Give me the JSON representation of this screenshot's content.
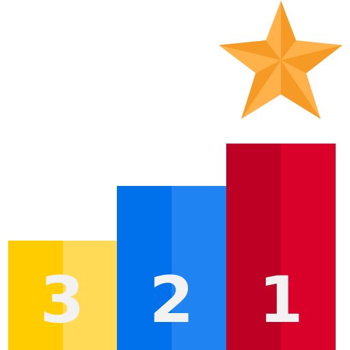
{
  "icon": {
    "name": "podium-ranking-icon",
    "star": {
      "icon_name": "star-icon"
    },
    "steps": [
      {
        "rank": "3",
        "icon_name": "third-place-step",
        "colors": {
          "dark": "#FFCC00",
          "light": "#FFDA57"
        }
      },
      {
        "rank": "2",
        "icon_name": "second-place-step",
        "colors": {
          "dark": "#0170EB",
          "light": "#1F84F2"
        }
      },
      {
        "rank": "1",
        "icon_name": "first-place-step",
        "colors": {
          "dark": "#BE0025",
          "light": "#D9002A"
        }
      }
    ],
    "colors": {
      "star_light": "#FFB24A",
      "star_dark": "#F59A25",
      "numeral": "#F2F2F2"
    }
  }
}
